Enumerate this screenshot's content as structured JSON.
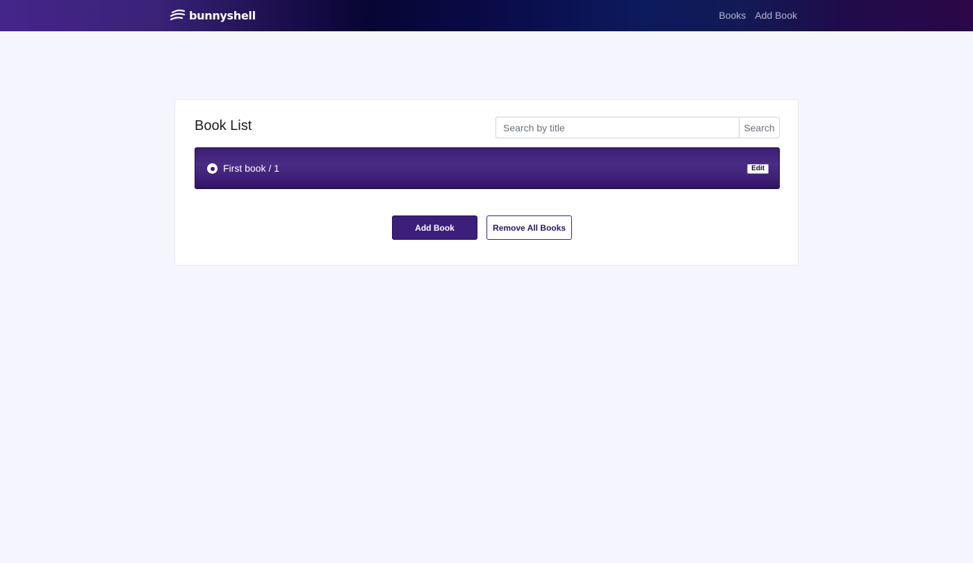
{
  "navbar": {
    "brand": "bunnyshell",
    "brand_icon": "wave-lines-icon",
    "links": [
      {
        "label": "Books"
      },
      {
        "label": "Add Book"
      }
    ]
  },
  "card": {
    "title": "Book List",
    "search": {
      "placeholder": "Search by title",
      "value": "",
      "button_label": "Search"
    },
    "books": [
      {
        "label": "First book / 1",
        "selected": true,
        "edit_label": "Edit"
      }
    ],
    "actions": {
      "add_label": "Add Book",
      "remove_all_label": "Remove All Books"
    }
  },
  "colors": {
    "accent": "#3b1f7a",
    "page_background": "#f5f5fd",
    "nav_link": "#b9b5cf"
  }
}
